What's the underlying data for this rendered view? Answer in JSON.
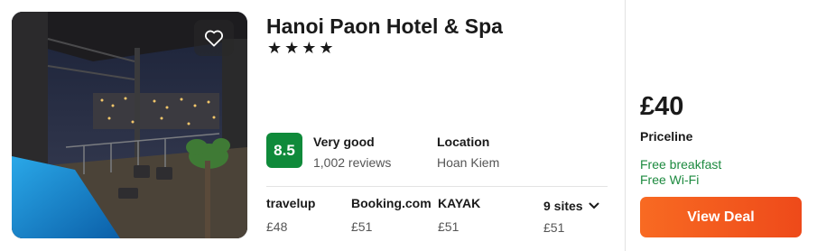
{
  "hotel": {
    "name": "Hanoi Paon Hotel & Spa",
    "stars": "★★★★"
  },
  "rating": {
    "score": "8.5",
    "label": "Very good",
    "reviews": "1,002 reviews"
  },
  "location": {
    "label": "Location",
    "value": "Hoan Kiem"
  },
  "sites": [
    {
      "name": "travelup",
      "price": "£48"
    },
    {
      "name": "Booking.com",
      "price": "£51"
    },
    {
      "name": "KAYAK",
      "price": "£51"
    }
  ],
  "more_sites": {
    "label": "9 sites",
    "price": "£51"
  },
  "offer": {
    "price": "£40",
    "provider": "Priceline",
    "features": [
      "Free breakfast",
      "Free Wi-Fi"
    ],
    "cta": "View Deal"
  },
  "colors": {
    "score_badge": "#0f8a3a",
    "feature_text": "#1d8a3f",
    "cta_start": "#f86a22",
    "cta_end": "#ee4a1a"
  },
  "icons": {
    "favorite": "heart-icon",
    "expand": "chevron-down-icon"
  }
}
